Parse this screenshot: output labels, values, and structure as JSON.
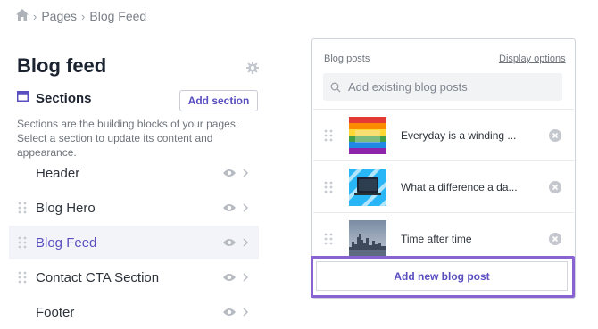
{
  "breadcrumb": {
    "home_icon": "home-icon",
    "items": [
      "Pages",
      "Blog Feed"
    ],
    "separator": "›"
  },
  "page": {
    "title": "Blog feed"
  },
  "sections_panel": {
    "label": "Sections",
    "add_button": "Add section",
    "description": "Sections are the building blocks of your pages. Select a section to update its content and appearance.",
    "items": [
      {
        "name": "Header",
        "active": false,
        "draggable": false
      },
      {
        "name": "Blog Hero",
        "active": false,
        "draggable": true
      },
      {
        "name": "Blog Feed",
        "active": true,
        "draggable": true
      },
      {
        "name": "Contact CTA Section",
        "active": false,
        "draggable": true
      },
      {
        "name": "Footer",
        "active": false,
        "draggable": false
      }
    ]
  },
  "blog_posts": {
    "label": "Blog posts",
    "display_options": "Display options",
    "search_placeholder": "Add existing blog posts",
    "posts": [
      {
        "title": "Everyday is a winding ...",
        "thumb": "rainbow-flag-image"
      },
      {
        "title": "What a difference a da...",
        "thumb": "laptop-image"
      },
      {
        "title": "Time after time",
        "thumb": "city-skyline-image"
      }
    ],
    "add_button": "Add new blog post"
  },
  "colors": {
    "accent": "#5a4fc0",
    "highlight_border": "#8a63d2",
    "active_row_bg": "#f3f4f9"
  }
}
